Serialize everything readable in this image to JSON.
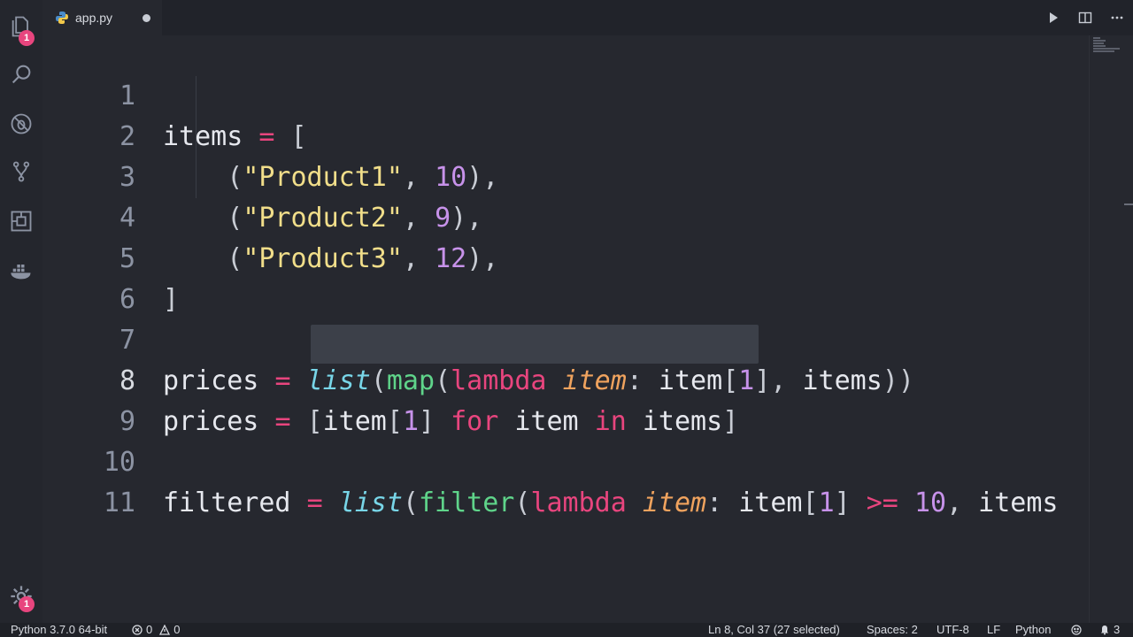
{
  "activity_bar": {
    "explorer_badge": "1",
    "manage_badge": "1"
  },
  "tab": {
    "label": "app.py"
  },
  "editor": {
    "line_numbers": [
      "1",
      "2",
      "3",
      "4",
      "5",
      "6",
      "7",
      "8",
      "9",
      "10",
      "11"
    ]
  },
  "status_bar": {
    "interpreter": "Python 3.7.0 64-bit",
    "errors": "0",
    "warnings": "0",
    "cursor": "Ln 8, Col 37 (27 selected)",
    "spaces": "Spaces: 2",
    "encoding": "UTF-8",
    "eol": "LF",
    "language": "Python",
    "notifications": "3"
  },
  "colors": {
    "background": "#26282f",
    "string": "#f1de8a",
    "number": "#c792ea",
    "function": "#5fd48a",
    "keyword": "#e8457e",
    "builtin_class": "#78d6e8",
    "parameter": "#f0a35e",
    "badge": "#e8457e"
  },
  "icons": [
    "files-icon",
    "search-icon",
    "debug-icon",
    "source-control-icon",
    "extensions-icon",
    "docker-icon",
    "gear-icon",
    "run-icon",
    "split-editor-icon",
    "more-actions-icon",
    "error-icon",
    "warning-icon",
    "feedback-icon",
    "bell-icon",
    "python-file-icon"
  ]
}
